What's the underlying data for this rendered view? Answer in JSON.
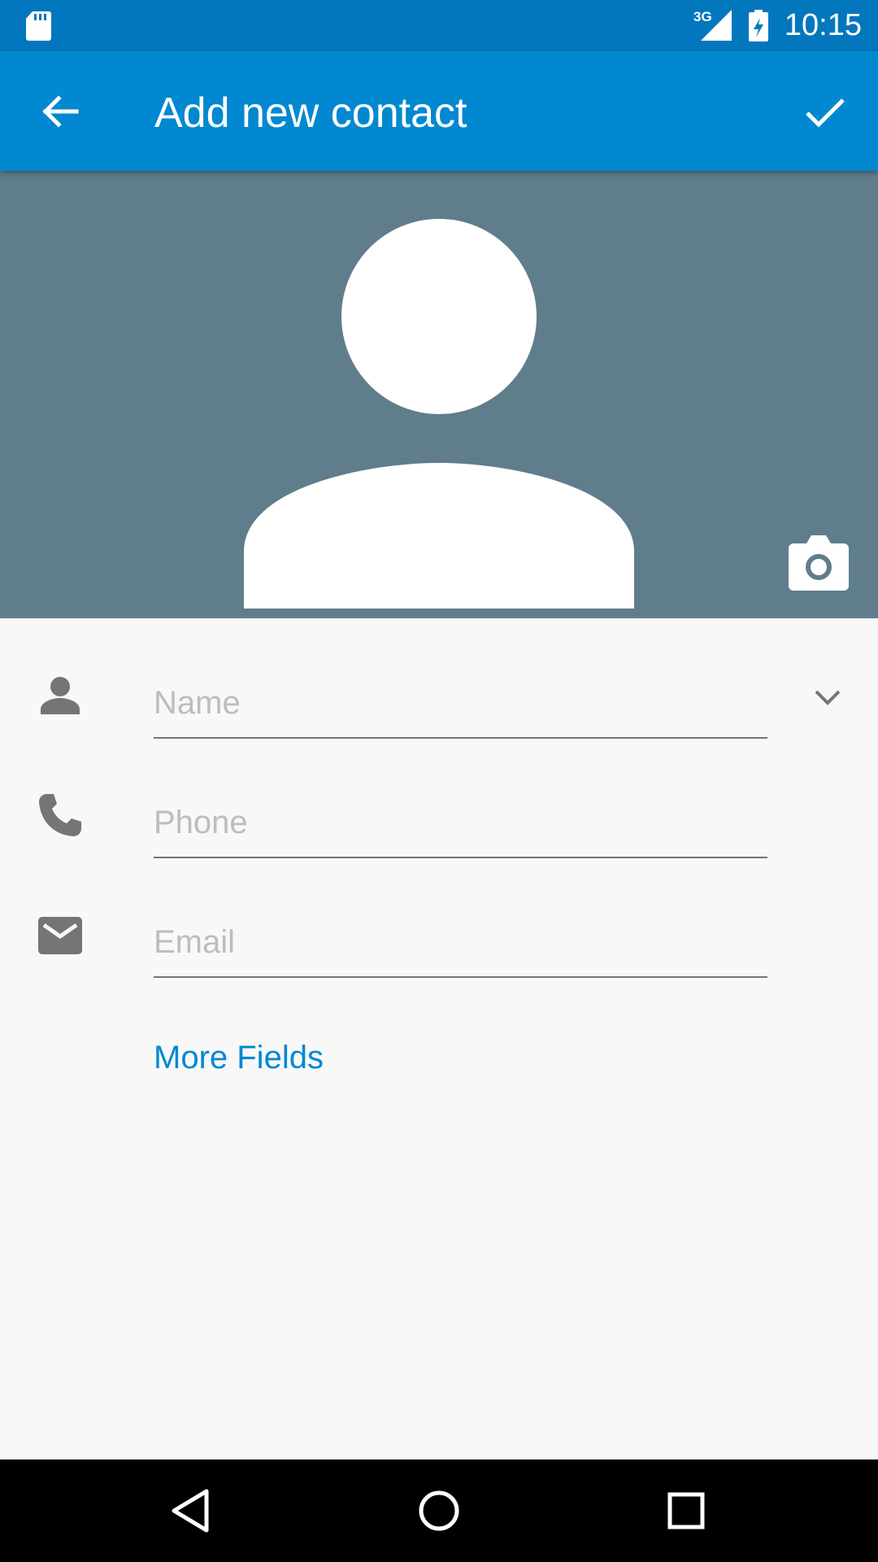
{
  "status_bar": {
    "time": "10:15",
    "network": "3G",
    "icons": [
      "sd-card-icon",
      "signal-icon",
      "battery-charging-icon"
    ]
  },
  "app_bar": {
    "title": "Add new contact",
    "back_icon": "arrow-back-icon",
    "save_icon": "check-icon"
  },
  "photo": {
    "avatar_icon": "person-placeholder-icon",
    "camera_icon": "camera-icon",
    "background_color": "#607d8b"
  },
  "form": {
    "name": {
      "placeholder": "Name",
      "value": "",
      "icon": "person-icon",
      "expand_icon": "chevron-down-icon"
    },
    "phone": {
      "placeholder": "Phone",
      "value": "",
      "icon": "phone-icon"
    },
    "email": {
      "placeholder": "Email",
      "value": "",
      "icon": "email-icon"
    },
    "more_fields_label": "More Fields"
  },
  "nav_bar": {
    "buttons": [
      "back-triangle-icon",
      "home-circle-icon",
      "recents-square-icon"
    ]
  },
  "colors": {
    "status_bar": "#0277bd",
    "app_bar": "#0288d1",
    "accent": "#0288d1",
    "background": "#f8f8f8"
  }
}
